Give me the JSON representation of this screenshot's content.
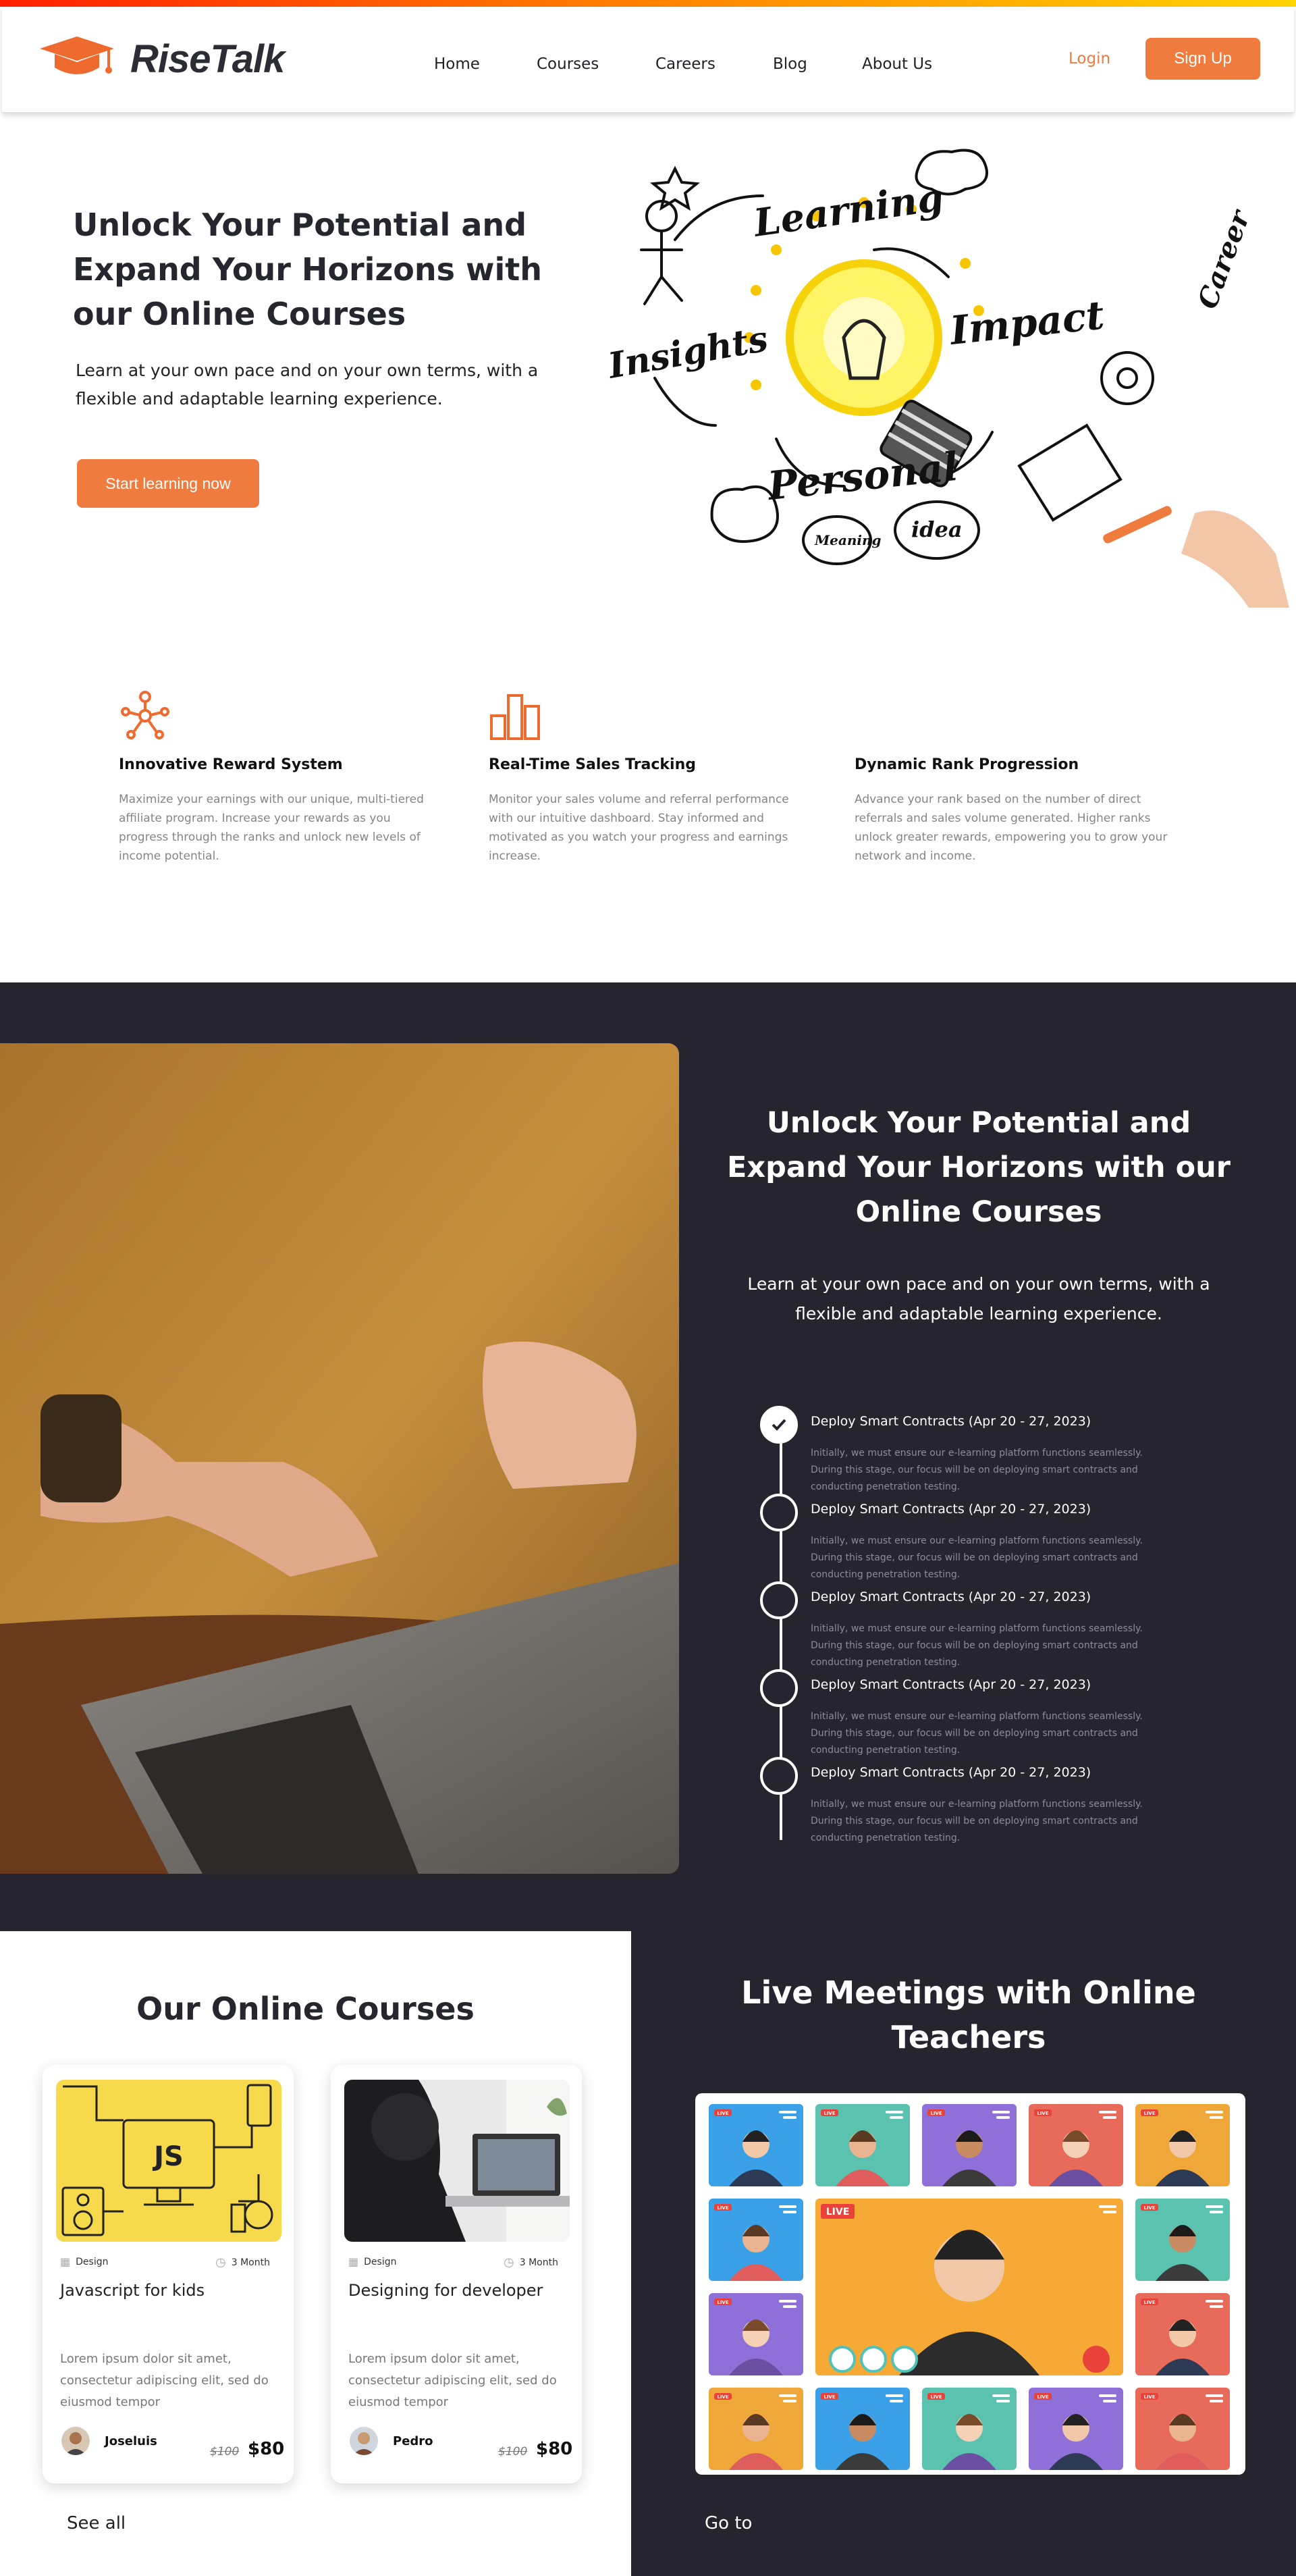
{
  "header": {
    "brand": "RiseTalk",
    "nav": [
      "Home",
      "Courses",
      "Careers",
      "Blog",
      "About Us"
    ],
    "login": "Login",
    "signup": "Sign Up"
  },
  "hero": {
    "title": "Unlock Your Potential and Expand Your Horizons with our Online Courses",
    "subtitle": "Learn at your own pace and on your own terms, with a flexible and adaptable learning experience.",
    "cta": "Start learning now",
    "doodle_words": [
      "Learning",
      "Impact",
      "Insights",
      "Personal",
      "idea",
      "Meaning",
      "Career"
    ]
  },
  "features": [
    {
      "icon": "network-icon",
      "title": "Innovative Reward System",
      "text": "Maximize your earnings with our unique, multi-tiered affiliate program. Increase your rewards as you progress through the ranks and unlock new levels of income potential."
    },
    {
      "icon": "bar-chart-icon",
      "title": "Real-Time Sales Tracking",
      "text": "Monitor your sales volume and referral performance with our intuitive dashboard. Stay informed and motivated as you watch your progress and earnings increase."
    },
    {
      "icon": "",
      "title": "Dynamic Rank Progression",
      "text": "Advance your rank based on the number of direct referrals and sales volume generated. Higher ranks unlock greater rewards, empowering you to grow your network and income."
    }
  ],
  "section2": {
    "title": "Unlock Your Potential and Expand Your Horizons with our Online Courses",
    "subtitle": "Learn at your own pace and on your own terms, with a flexible and adaptable learning experience.",
    "timeline": [
      {
        "title": "Deploy Smart Contracts (Apr 20 - 27, 2023)",
        "desc": "Initially, we must ensure our e-learning platform functions seamlessly. During this stage, our focus will be on deploying smart contracts and conducting penetration testing.",
        "done": true
      },
      {
        "title": "Deploy Smart Contracts (Apr 20 - 27, 2023)",
        "desc": "Initially, we must ensure our e-learning platform functions seamlessly. During this stage, our focus will be on deploying smart contracts and conducting penetration testing.",
        "done": false
      },
      {
        "title": "Deploy Smart Contracts (Apr 20 - 27, 2023)",
        "desc": "Initially, we must ensure our e-learning platform functions seamlessly. During this stage, our focus will be on deploying smart contracts and conducting penetration testing.",
        "done": false
      },
      {
        "title": "Deploy Smart Contracts (Apr 20 - 27, 2023)",
        "desc": "Initially, we must ensure our e-learning platform functions seamlessly. During this stage, our focus will be on deploying smart contracts and conducting penetration testing.",
        "done": false
      },
      {
        "title": "Deploy Smart Contracts (Apr 20 - 27, 2023)",
        "desc": "Initially, we must ensure our e-learning platform functions seamlessly. During this stage, our focus will be on deploying smart contracts and conducting penetration testing.",
        "done": false
      }
    ]
  },
  "courses": {
    "title": "Our Online Courses",
    "see_all": "See all",
    "items": [
      {
        "category": "Design",
        "duration": "3 Month",
        "title": "Javascript for kids",
        "desc": "Lorem ipsum dolor sit amet, consectetur adipiscing elit, sed do eiusmod tempor",
        "author": "Joseluis",
        "old_price": "$100",
        "price": "$80",
        "thumb_text": "JS"
      },
      {
        "category": "Design",
        "duration": "3 Month",
        "title": "Designing for developer",
        "desc": "Lorem ipsum dolor sit amet, consectetur adipiscing elit, sed do eiusmod tempor",
        "author": "Pedro",
        "old_price": "$100",
        "price": "$80"
      }
    ]
  },
  "meetings": {
    "title": "Live Meetings with Online Teachers",
    "live_badge": "LIVE",
    "go_to": "Go to"
  },
  "colors": {
    "accent": "#ef7b3f",
    "dark": "#26252f"
  }
}
